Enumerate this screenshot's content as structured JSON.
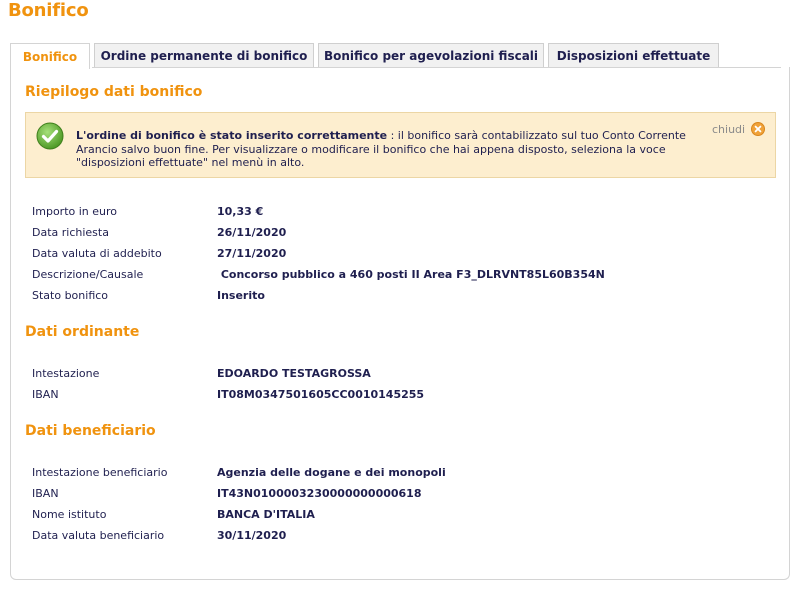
{
  "page": {
    "title": "Bonifico"
  },
  "tabs": [
    {
      "label": "Bonifico",
      "active": true
    },
    {
      "label": "Ordine permanente di bonifico",
      "active": false
    },
    {
      "label": "Bonifico per agevolazioni fiscali",
      "active": false
    },
    {
      "label": "Disposizioni effettuate",
      "active": false
    }
  ],
  "summary": {
    "title": "Riepilogo dati bonifico",
    "notice": {
      "bold": "L'ordine di bonifico è stato inserito correttamente",
      "text": " : il bonifico sarà contabilizzato sul tuo Conto Corrente Arancio salvo buon fine. Per visualizzare o modificare il bonifico che hai appena disposto, seleziona la voce \"disposizioni effettuate\" nel menù in alto.",
      "close_label": "chiudi",
      "icon": "check-circle-icon"
    },
    "rows": [
      {
        "label": "Importo in euro",
        "value": "10,33 €"
      },
      {
        "label": "Data richiesta",
        "value": "26/11/2020"
      },
      {
        "label": "Data valuta di addebito",
        "value": "27/11/2020"
      },
      {
        "label": "Descrizione/Causale",
        "value": " Concorso pubblico a 460 posti II Area F3_DLRVNT85L60B354N"
      },
      {
        "label": "Stato bonifico",
        "value": "Inserito"
      }
    ]
  },
  "ordinante": {
    "title": "Dati ordinante",
    "rows": [
      {
        "label": "Intestazione",
        "value": "EDOARDO TESTAGROSSA"
      },
      {
        "label": "IBAN",
        "value": "IT08M0347501605CC0010145255"
      }
    ]
  },
  "beneficiario": {
    "title": "Dati beneficiario",
    "rows": [
      {
        "label": "Intestazione beneficiario",
        "value": "Agenzia delle dogane e dei monopoli"
      },
      {
        "label": "IBAN",
        "value": "IT43N0100003230000000000618"
      },
      {
        "label": "Nome istituto",
        "value": "BANCA D'ITALIA"
      },
      {
        "label": "Data valuta beneficiario",
        "value": "30/11/2020"
      }
    ]
  },
  "colors": {
    "accent": "#f0930f",
    "text": "#1f1f4f",
    "notice_bg": "#fdeecf"
  }
}
